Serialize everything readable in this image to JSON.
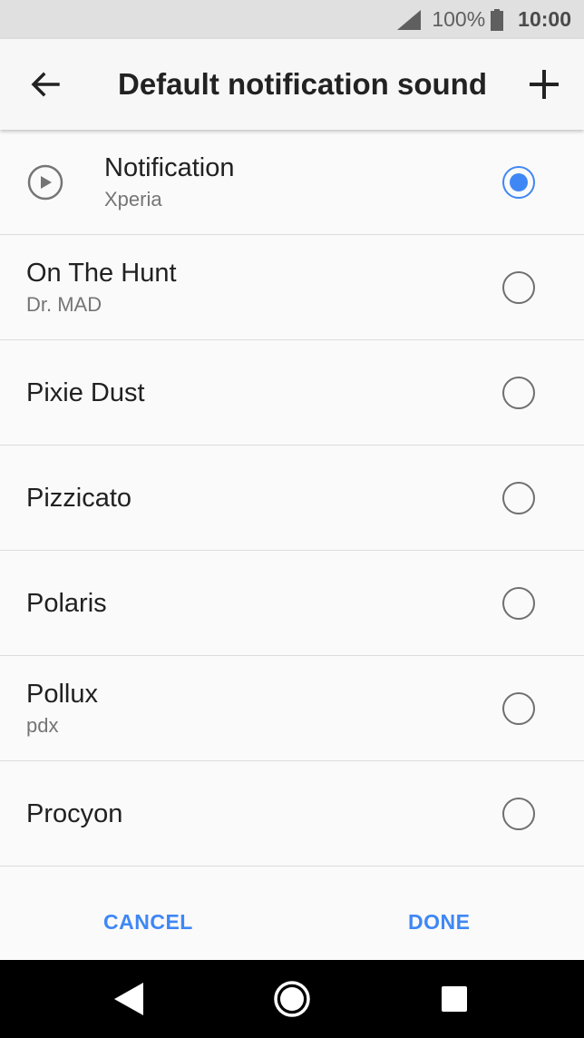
{
  "status_bar": {
    "battery_percent": "100%",
    "time": "10:00",
    "icons": [
      "signal-icon",
      "battery-icon"
    ]
  },
  "app_bar": {
    "title": "Default notification sound",
    "back_icon": "arrow-left-icon",
    "add_icon": "plus-icon"
  },
  "sounds": [
    {
      "name": "Notification",
      "subtitle": "Xperia",
      "selected": true,
      "has_play": true
    },
    {
      "name": "On The Hunt",
      "subtitle": "Dr. MAD",
      "selected": false
    },
    {
      "name": "Pixie Dust",
      "subtitle": "",
      "selected": false
    },
    {
      "name": "Pizzicato",
      "subtitle": "",
      "selected": false
    },
    {
      "name": "Polaris",
      "subtitle": "",
      "selected": false
    },
    {
      "name": "Pollux",
      "subtitle": "pdx",
      "selected": false
    },
    {
      "name": "Procyon",
      "subtitle": "",
      "selected": false
    }
  ],
  "actions": {
    "cancel_label": "CANCEL",
    "done_label": "DONE"
  },
  "nav_bar": {
    "icons": [
      "back-triangle-icon",
      "home-circle-icon",
      "recents-square-icon"
    ]
  },
  "colors": {
    "accent": "#3f87f5",
    "status_bar_bg": "#e0e0e0",
    "nav_bar_bg": "#000000"
  }
}
